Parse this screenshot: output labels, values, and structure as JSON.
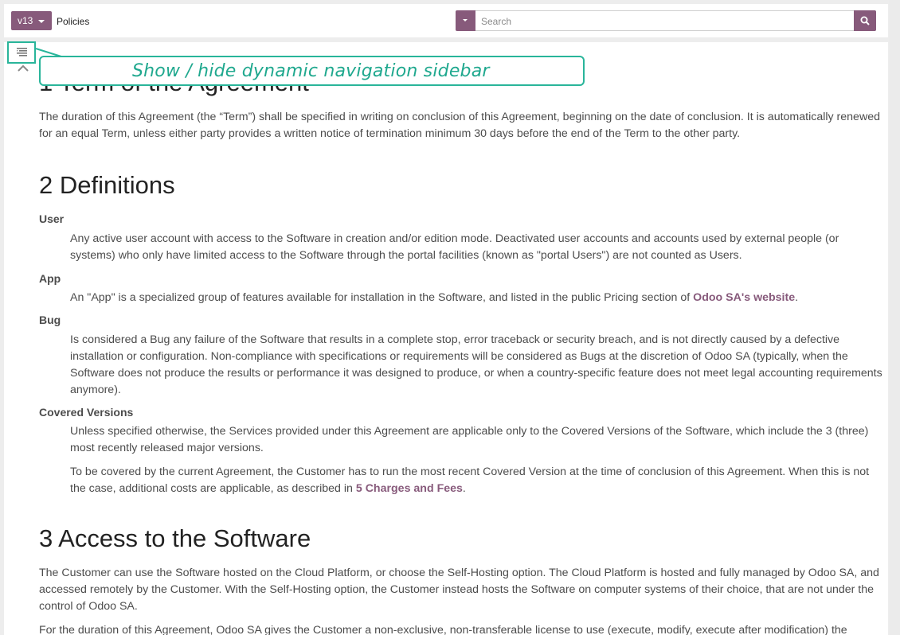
{
  "header": {
    "version": "v13",
    "breadcrumb": "Policies",
    "search_placeholder": "Search"
  },
  "callout": {
    "text": "Show / hide dynamic navigation sidebar"
  },
  "doc": {
    "s1_title": "1 Term of the Agreement",
    "s1_p": "The duration of this Agreement (the “Term”) shall be specified in writing on conclusion of this Agreement, beginning on the date of conclusion. It is automatically renewed for an equal Term, unless either party provides a written notice of termination minimum 30 days before the end of the Term to the other party.",
    "s2_title": "2 Definitions",
    "user_term": "User",
    "user_def": "Any active user account with access to the Software in creation and/or edition mode. Deactivated user accounts and accounts used by external people (or systems) who only have limited access to the Software through the portal facilities (known as \"portal Users\") are not counted as Users.",
    "app_term": "App",
    "app_def_pre": "An \"App\" is a specialized group of features available for installation in the Software, and listed in the public Pricing section of ",
    "app_def_link": "Odoo SA's website",
    "app_def_post": ".",
    "bug_term": "Bug",
    "bug_def": "Is considered a Bug any failure of the Software that results in a complete stop, error traceback or security breach, and is not directly caused by a defective installation or configuration. Non-compliance with specifications or requirements will be considered as Bugs at the discretion of Odoo SA (typically, when the Software does not produce the results or performance it was designed to produce, or when a country-specific feature does not meet legal accounting requirements anymore).",
    "cv_term": "Covered Versions",
    "cv_def1": "Unless specified otherwise, the Services provided under this Agreement are applicable only to the Covered Versions of the Software, which include the 3 (three) most recently released major versions.",
    "cv_def2_pre": "To be covered by the current Agreement, the Customer has to run the most recent Covered Version at the time of conclusion of this Agreement. When this is not the case, additional costs are applicable, as described in ",
    "cv_def2_link": "5 Charges and Fees",
    "cv_def2_post": ".",
    "s3_title": "3 Access to the Software",
    "s3_p1": "The Customer can use the Software hosted on the Cloud Platform, or choose the Self-Hosting option. The Cloud Platform is hosted and fully managed by Odoo SA, and accessed remotely by the Customer. With the Self-Hosting option, the Customer instead hosts the Software on computer systems of their choice, that are not under the control of Odoo SA.",
    "s3_p2": "For the duration of this Agreement, Odoo SA gives the Customer a non-exclusive, non-transferable license to use (execute, modify, execute after modification) the"
  }
}
